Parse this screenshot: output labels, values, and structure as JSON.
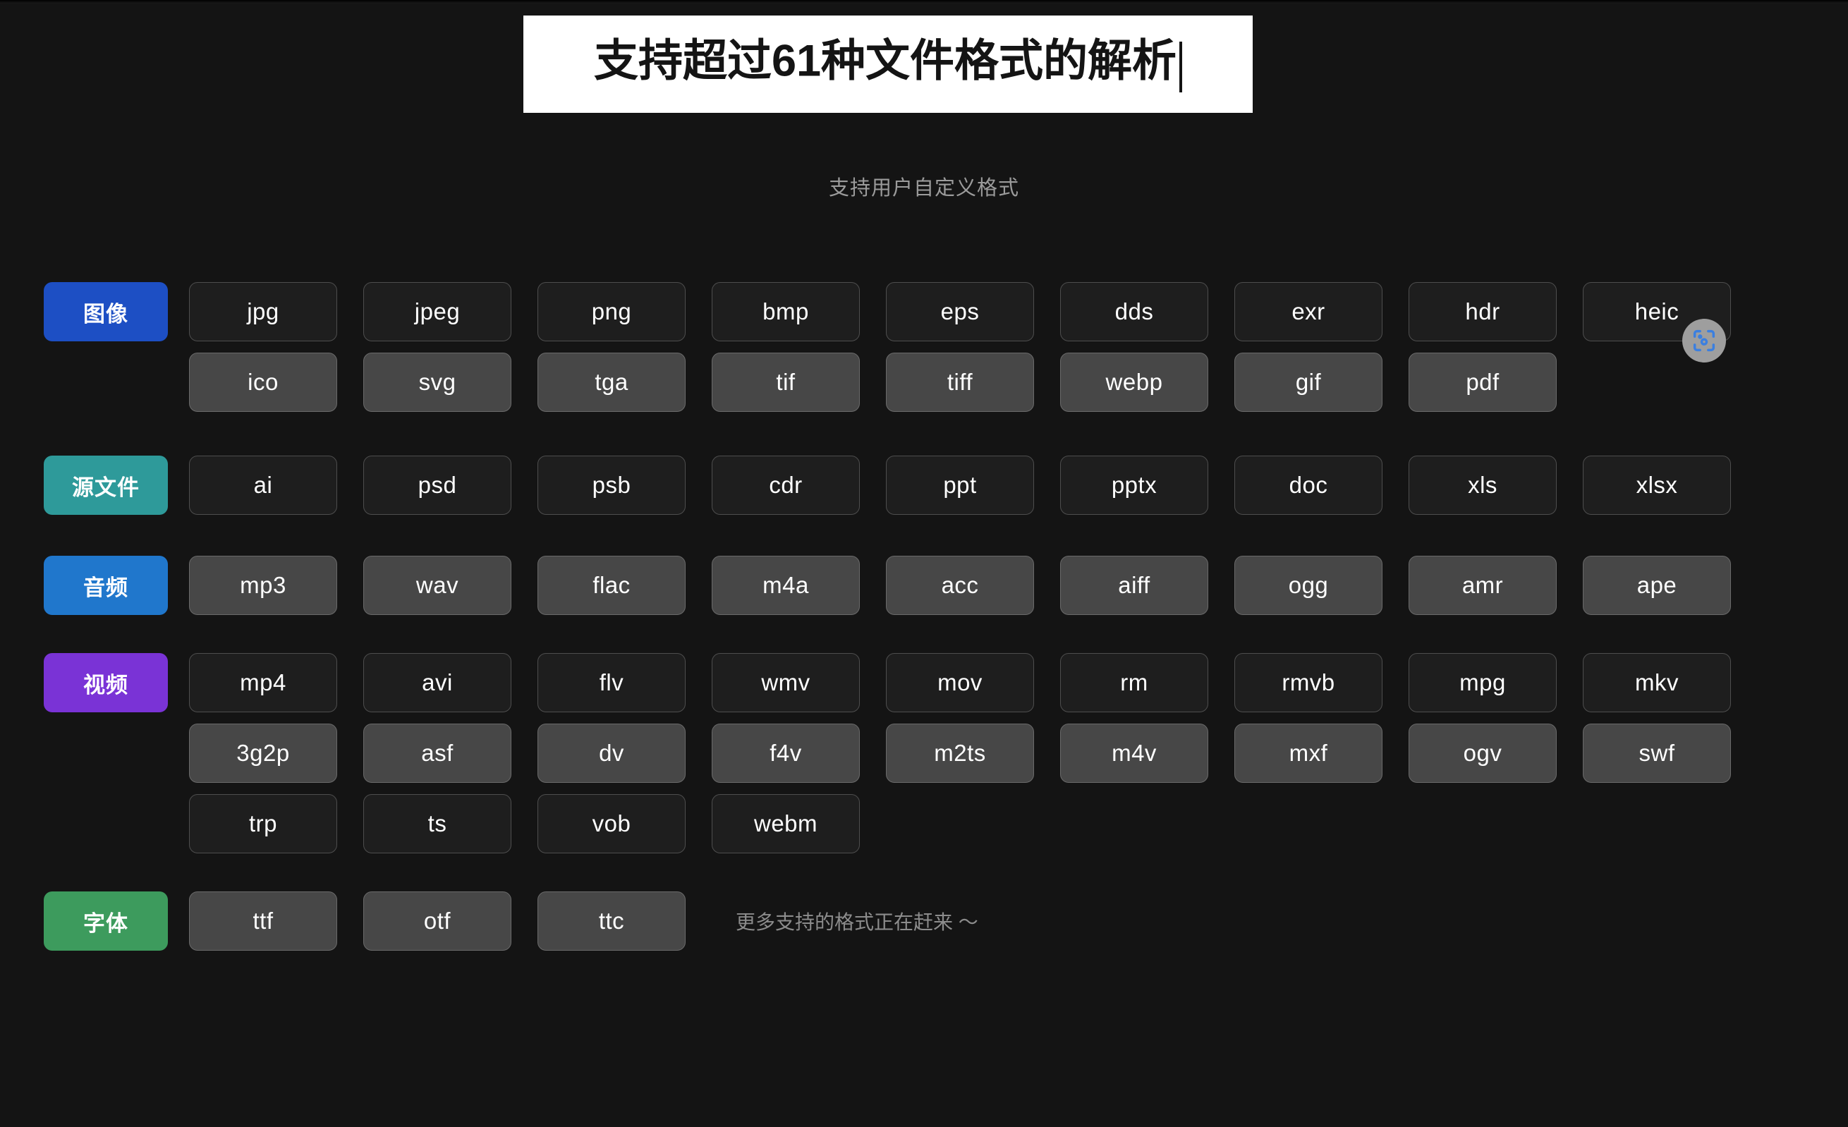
{
  "page": {
    "background_color": "#141414",
    "title": "支持超过61种文件格式的解析",
    "subtitle": "支持用户自定义格式",
    "footer_note": "更多支持的格式正在赶来 ～"
  },
  "categories": [
    {
      "name": "图像",
      "color": "#1d4fc4",
      "rows": [
        {
          "style": "dark",
          "tags": [
            "jpg",
            "jpeg",
            "png",
            "bmp",
            "eps",
            "dds",
            "exr",
            "hdr",
            "heic"
          ]
        },
        {
          "style": "light",
          "tags": [
            "ico",
            "svg",
            "tga",
            "tif",
            "tiff",
            "webp",
            "gif",
            "pdf"
          ]
        }
      ]
    },
    {
      "name": "源文件",
      "color": "#2e9a9a",
      "rows": [
        {
          "style": "dark",
          "tags": [
            "ai",
            "psd",
            "psb",
            "cdr",
            "ppt",
            "pptx",
            "doc",
            "xls",
            "xlsx"
          ]
        }
      ]
    },
    {
      "name": "音频",
      "color": "#2077cc",
      "rows": [
        {
          "style": "light",
          "tags": [
            "mp3",
            "wav",
            "flac",
            "m4a",
            "acc",
            "aiff",
            "ogg",
            "amr",
            "ape"
          ]
        }
      ]
    },
    {
      "name": "视频",
      "color": "#7a33d6",
      "rows": [
        {
          "style": "dark",
          "tags": [
            "mp4",
            "avi",
            "flv",
            "wmv",
            "mov",
            "rm",
            "rmvb",
            "mpg",
            "mkv"
          ]
        },
        {
          "style": "light",
          "tags": [
            "3g2p",
            "asf",
            "dv",
            "f4v",
            "m2ts",
            "m4v",
            "mxf",
            "ogv",
            "swf"
          ]
        },
        {
          "style": "dark",
          "tags": [
            "trp",
            "ts",
            "vob",
            "webm"
          ]
        }
      ]
    },
    {
      "name": "字体",
      "color": "#3d9b5d",
      "rows": [
        {
          "style": "light",
          "tags": [
            "ttf",
            "otf",
            "ttc"
          ],
          "note": "更多支持的格式正在赶来 ～"
        }
      ]
    }
  ],
  "overlay": {
    "icon": "screenshot-capture-icon",
    "circle_color": "#9e9e9e",
    "icon_color": "#3b7fe0"
  }
}
